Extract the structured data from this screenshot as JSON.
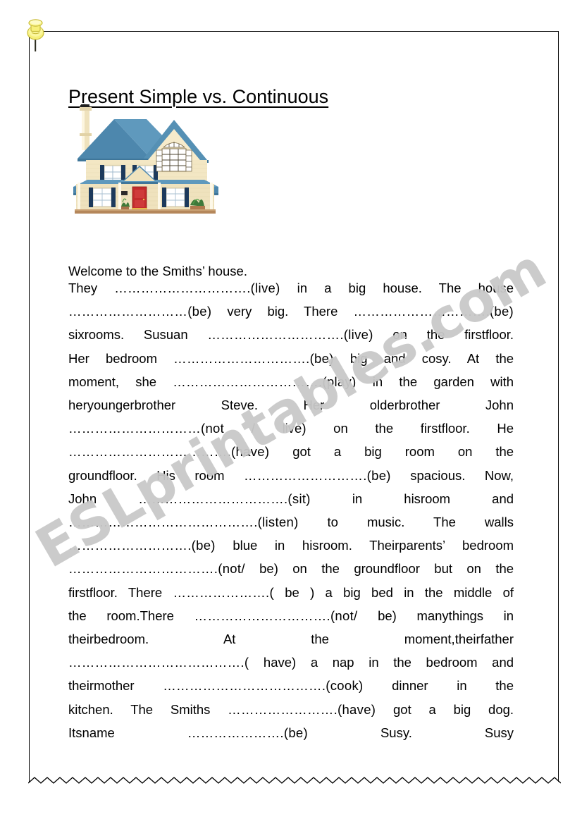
{
  "page": {
    "title": "Present Simple vs. Continuous",
    "watermark": "ESLprintables.com",
    "pin_icon": "push-pin-icon",
    "house_icon": "house-illustration"
  },
  "worksheet": {
    "intro": "Welcome to the Smiths’ house.",
    "paragraph_lines": [
      "They ………………………….(live) in a big house.  The house",
      "………………………(be) very big. There ………………………….(be)",
      "sixrooms.  Susuan ………………………….(live) on the firstfloor.",
      "Her bedroom ………………………….(be) big and cosy. At the",
      "moment, she …………………………….(play) in the garden with",
      "heryoungerbrother Steve.  Her olderbrother  John",
      "…………………………(not / live) on the firstfloor. He",
      "……………………………….(have) got a big room on the",
      "groundfloor. His room ……………………….(be) spacious. Now,",
      "John …………………………….(sit) in hisroom and",
      "…………………………………….(listen) to music. The walls",
      "……………………….(be) blue in hisroom. Theirparents’ bedroom",
      "…………………………….(not/ be) on the groundfloor but on the",
      "firstfloor.  There ………………….( be ) a big bed in the middle of",
      "the room.There ………………………….(not/ be) manythings in",
      "theirbedroom.  At the moment,theirfather",
      "………………………………….( have) a nap in the bedroom and",
      "theirmother ……………………………….(cook) dinner in the",
      "kitchen. The Smiths …………………….(have) got a big dog.",
      "Itsname ………………….(be) Susy.  Susy"
    ]
  },
  "colors": {
    "text": "#000000",
    "watermark": "#c9c9c9",
    "border": "#000000",
    "roof": "#4d87ad",
    "siding": "#f3e7c4",
    "door": "#c22b2b",
    "shutter": "#1d3a5c",
    "pin": "#f7f07a"
  }
}
